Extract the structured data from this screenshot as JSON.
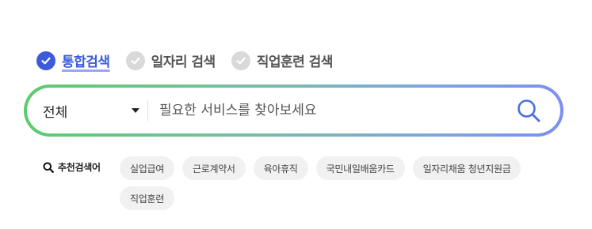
{
  "tabs": [
    {
      "label": "통합검색",
      "active": true
    },
    {
      "label": "일자리 검색",
      "active": false
    },
    {
      "label": "직업훈련 검색",
      "active": false
    }
  ],
  "search": {
    "scope_value": "전체",
    "placeholder": "필요한 서비스를 찾아보세요",
    "value": ""
  },
  "recommended": {
    "label": "추천검색어",
    "chips": [
      "실업급여",
      "근로계약서",
      "육아휴직",
      "국민내일배움카드",
      "일자리채움 청년지원금",
      "직업훈련"
    ]
  },
  "colors": {
    "accent": "#3b5bdb",
    "gradient_start": "#5ccb6e",
    "gradient_end": "#7c8ff0",
    "chip_bg": "#f1f1f1"
  },
  "icons": {
    "tab_check": "check-circle-icon",
    "scope_caret": "caret-down-icon",
    "search": "search-icon",
    "recommend": "magnifier-icon"
  }
}
